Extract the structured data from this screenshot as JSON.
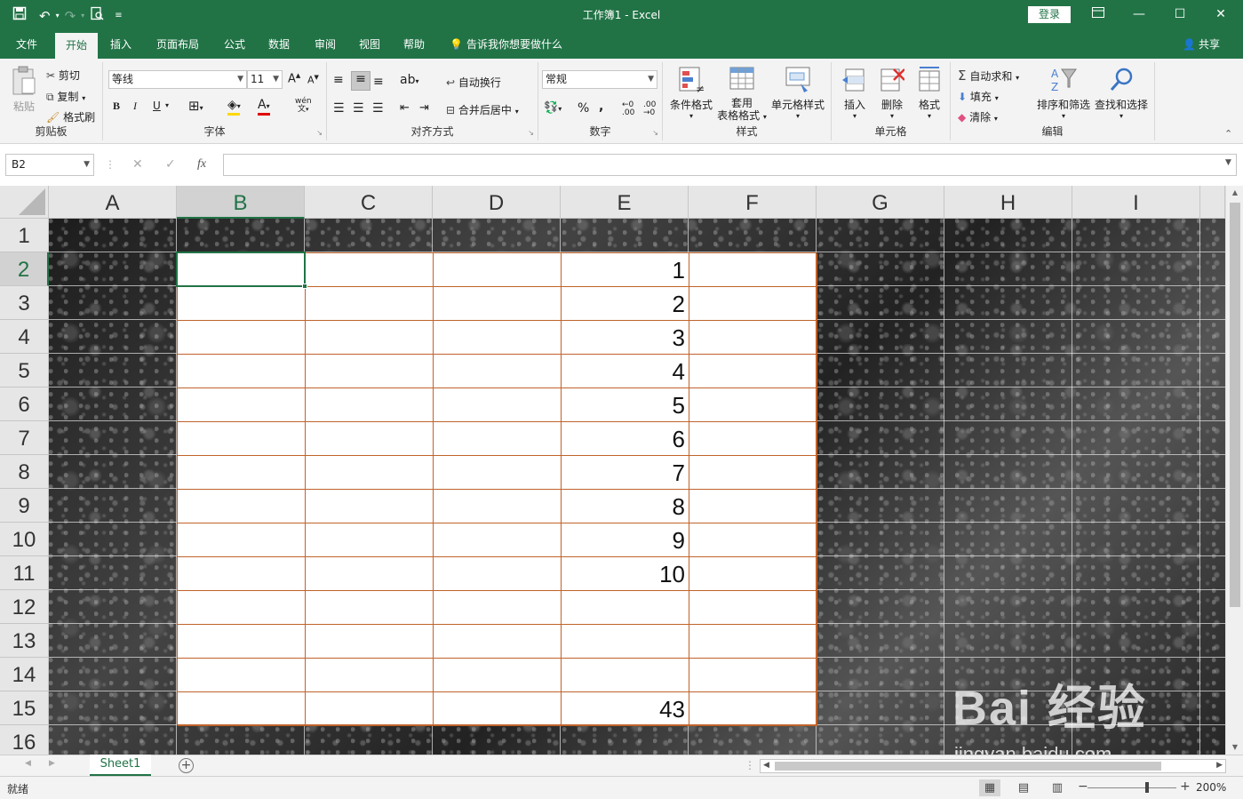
{
  "app": {
    "title": "工作簿1  -  Excel",
    "login": "登录",
    "share": "共享",
    "tell_me": "告诉我你想要做什么"
  },
  "tabs": [
    {
      "label": "文件"
    },
    {
      "label": "开始"
    },
    {
      "label": "插入"
    },
    {
      "label": "页面布局"
    },
    {
      "label": "公式"
    },
    {
      "label": "数据"
    },
    {
      "label": "审阅"
    },
    {
      "label": "视图"
    },
    {
      "label": "帮助"
    }
  ],
  "ribbon": {
    "clipboard": {
      "label": "剪贴板",
      "paste": "粘贴",
      "cut": "剪切",
      "copy": "复制",
      "format_painter": "格式刷"
    },
    "font": {
      "label": "字体",
      "name": "等线",
      "size": "11",
      "bold": "B",
      "italic": "I",
      "underline": "U",
      "wen": "wén"
    },
    "alignment": {
      "label": "对齐方式",
      "wrap": "自动换行",
      "merge": "合并后居中"
    },
    "number": {
      "label": "数字",
      "format": "常规",
      "percent": "%",
      "comma": ","
    },
    "styles": {
      "label": "样式",
      "conditional": "条件格式",
      "table_top": "套用",
      "table_bottom": "表格格式",
      "cell_styles": "单元格样式"
    },
    "cells": {
      "label": "单元格",
      "insert": "插入",
      "delete": "删除",
      "format": "格式"
    },
    "editing": {
      "label": "编辑",
      "autosum": "自动求和",
      "fill": "填充",
      "clear": "清除",
      "sort": "排序和筛选",
      "find": "查找和选择"
    }
  },
  "formula_bar": {
    "name_box": "B2",
    "fx": "fx",
    "value": ""
  },
  "columns": [
    "A",
    "B",
    "C",
    "D",
    "E",
    "F",
    "G",
    "H",
    "I"
  ],
  "rows": [
    "1",
    "2",
    "3",
    "4",
    "5",
    "6",
    "7",
    "8",
    "9",
    "10",
    "11",
    "12",
    "13",
    "14",
    "15",
    "16"
  ],
  "selected": {
    "column": "B",
    "row": "2"
  },
  "column_e_values": [
    "1",
    "2",
    "3",
    "4",
    "5",
    "6",
    "7",
    "8",
    "9",
    "10",
    "",
    "",
    "",
    "43"
  ],
  "sheets": [
    {
      "name": "Sheet1"
    }
  ],
  "status": {
    "ready": "就绪",
    "zoom": "200%"
  },
  "watermark": {
    "logo": "Bai  经验",
    "url": "jingyan.baidu.com"
  },
  "colors": {
    "accent": "#217346",
    "table_border": "#c0632a"
  }
}
